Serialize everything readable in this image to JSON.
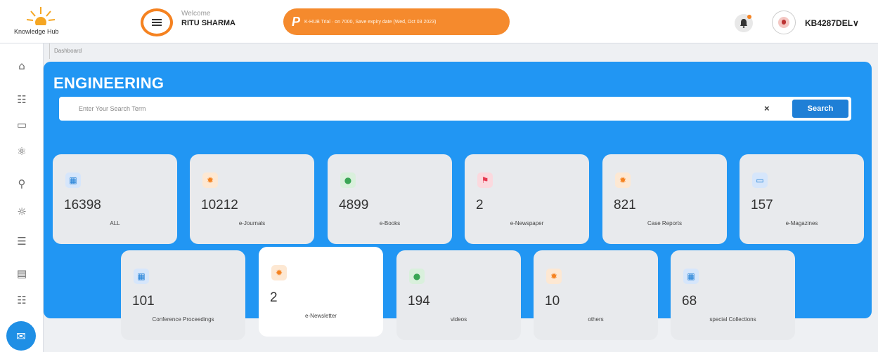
{
  "header": {
    "logo_text": "Knowledge Hub",
    "welcome": "Welcome",
    "user_name": "RITU SHARMA",
    "promo_icon": "P",
    "promo_text": "K-HUB Trial · on 7000, Save expiry date (Wed, Oct 03 2023)",
    "user_code": "KB4287DEL∨"
  },
  "breadcrumb": "Dashboard",
  "sidebar": {
    "icons": [
      "dashboard-icon",
      "users-icon",
      "monitor-icon",
      "atom-icon",
      "person-desk-icon",
      "hand-icon",
      "settings-list-icon",
      "id-card-icon",
      "group-icon"
    ],
    "fab_icon": "chat-icon"
  },
  "panel": {
    "title": "ENGINEERING",
    "search_placeholder": "Enter Your Search Term",
    "clear": "×",
    "search_button": "Search"
  },
  "cards": [
    {
      "count": "16398",
      "label": "ALL",
      "icon": "grid-icon"
    },
    {
      "count": "10212",
      "label": "e-Journals",
      "icon": "sun-icon"
    },
    {
      "count": "4899",
      "label": "e-Books",
      "icon": "user-icon"
    },
    {
      "count": "2",
      "label": "e-Newspaper",
      "icon": "flag-icon"
    },
    {
      "count": "821",
      "label": "Case Reports",
      "icon": "sun-icon"
    },
    {
      "count": "157",
      "label": "e-Magazines",
      "icon": "magazine-icon"
    },
    {
      "count": "101",
      "label": "Conference Proceedings",
      "icon": "grid-icon"
    },
    {
      "count": "2",
      "label": "e-Newsletter",
      "icon": "sun-icon"
    },
    {
      "count": "194",
      "label": "videos",
      "icon": "user-icon"
    },
    {
      "count": "10",
      "label": "others",
      "icon": "sun-icon"
    },
    {
      "count": "68",
      "label": "special Collections",
      "icon": "grid-icon"
    }
  ],
  "colors": {
    "accent": "#2196f3",
    "orange": "#f58220",
    "card_bg": "#e8eaed"
  }
}
